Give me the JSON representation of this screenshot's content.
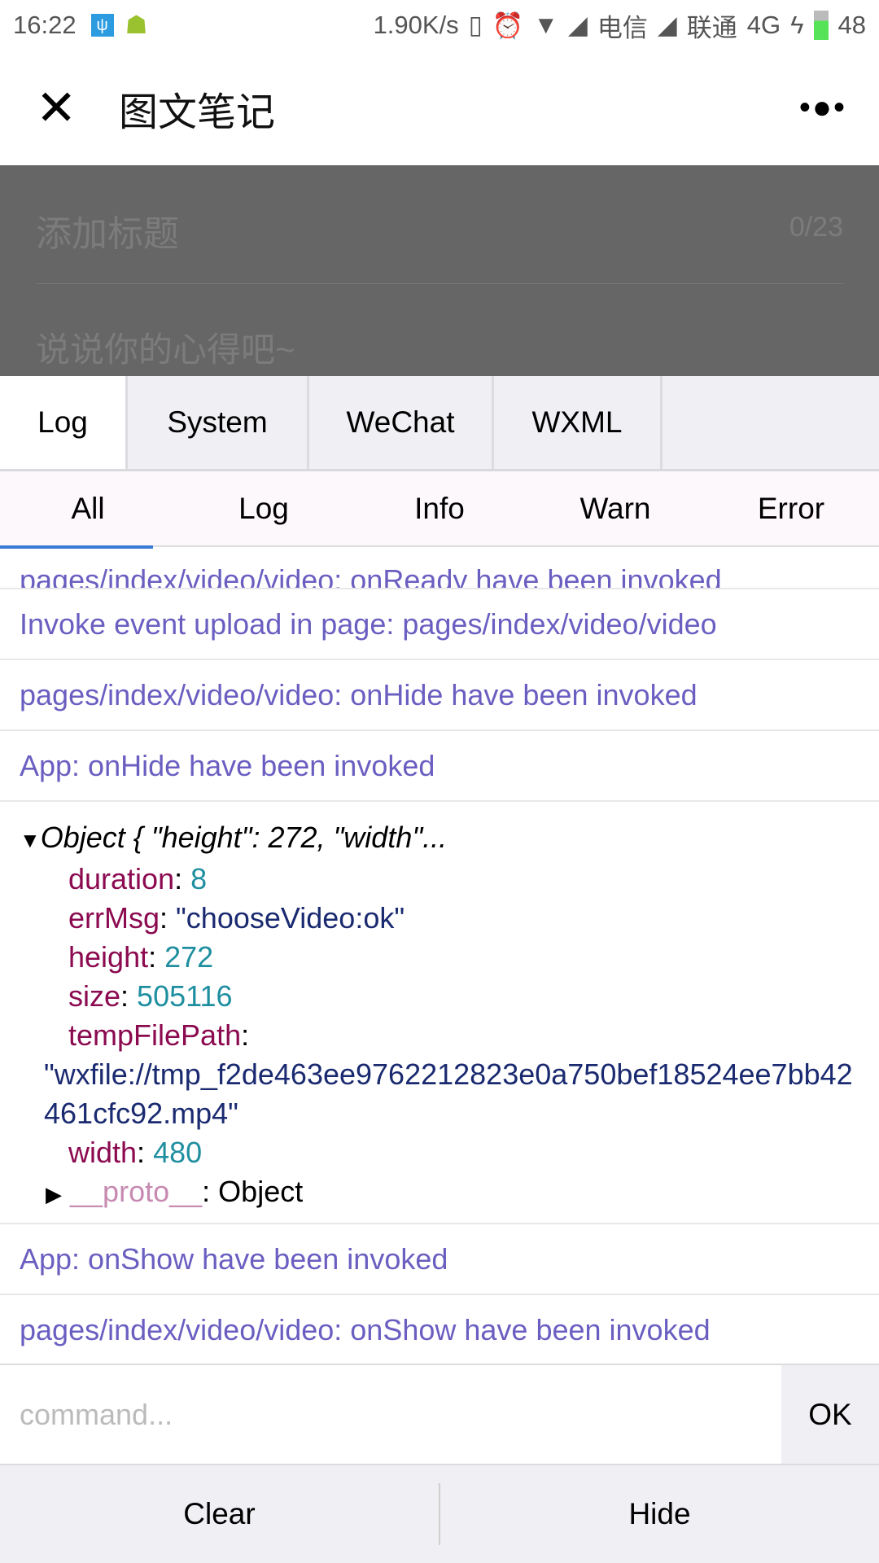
{
  "status_bar": {
    "time": "16:22",
    "net_speed": "1.90K/s",
    "carrier1": "电信",
    "carrier2": "联通",
    "network": "4G",
    "battery": "48"
  },
  "nav": {
    "title": "图文笔记",
    "close_icon": "close-icon",
    "more_icon": "more-dots-icon"
  },
  "editor": {
    "title_placeholder": "添加标题",
    "title_count": "0/23",
    "body_placeholder": "说说你的心得吧~"
  },
  "console": {
    "tabs": [
      {
        "label": "Log",
        "active": true
      },
      {
        "label": "System"
      },
      {
        "label": "WeChat"
      },
      {
        "label": "WXML"
      }
    ],
    "filters": [
      {
        "label": "All",
        "active": true
      },
      {
        "label": "Log"
      },
      {
        "label": "Info"
      },
      {
        "label": "Warn"
      },
      {
        "label": "Error"
      }
    ],
    "logs_before": [
      "pages/index/video/video: onReady have been invoked",
      "Invoke event upload in page: pages/index/video/video",
      "pages/index/video/video: onHide have been invoked",
      "App: onHide have been invoked"
    ],
    "object": {
      "summary": "Object { \"height\": 272, \"width\"...",
      "fields": {
        "duration_k": "duration",
        "duration_v": "8",
        "errMsg_k": "errMsg",
        "errMsg_v": "\"chooseVideo:ok\"",
        "height_k": "height",
        "height_v": "272",
        "size_k": "size",
        "size_v": "505116",
        "temp_k": "tempFilePath",
        "temp_v": "\"wxfile://tmp_f2de463ee9762212823e0a750bef18524ee7bb42461cfc92.mp4\"",
        "width_k": "width",
        "width_v": "480",
        "proto_k": "__proto__",
        "proto_v": "Object"
      }
    },
    "logs_after": [
      "App: onShow have been invoked",
      "pages/index/video/video: onShow have been invoked"
    ],
    "command_placeholder": "command...",
    "ok_label": "OK",
    "clear_label": "Clear",
    "hide_label": "Hide",
    "colors": {
      "log_text": "#6a5fc1",
      "key": "#8b0a50",
      "number": "#1f8fa0",
      "string": "#1a2a70",
      "active_filter": "#3a7bd5"
    }
  }
}
